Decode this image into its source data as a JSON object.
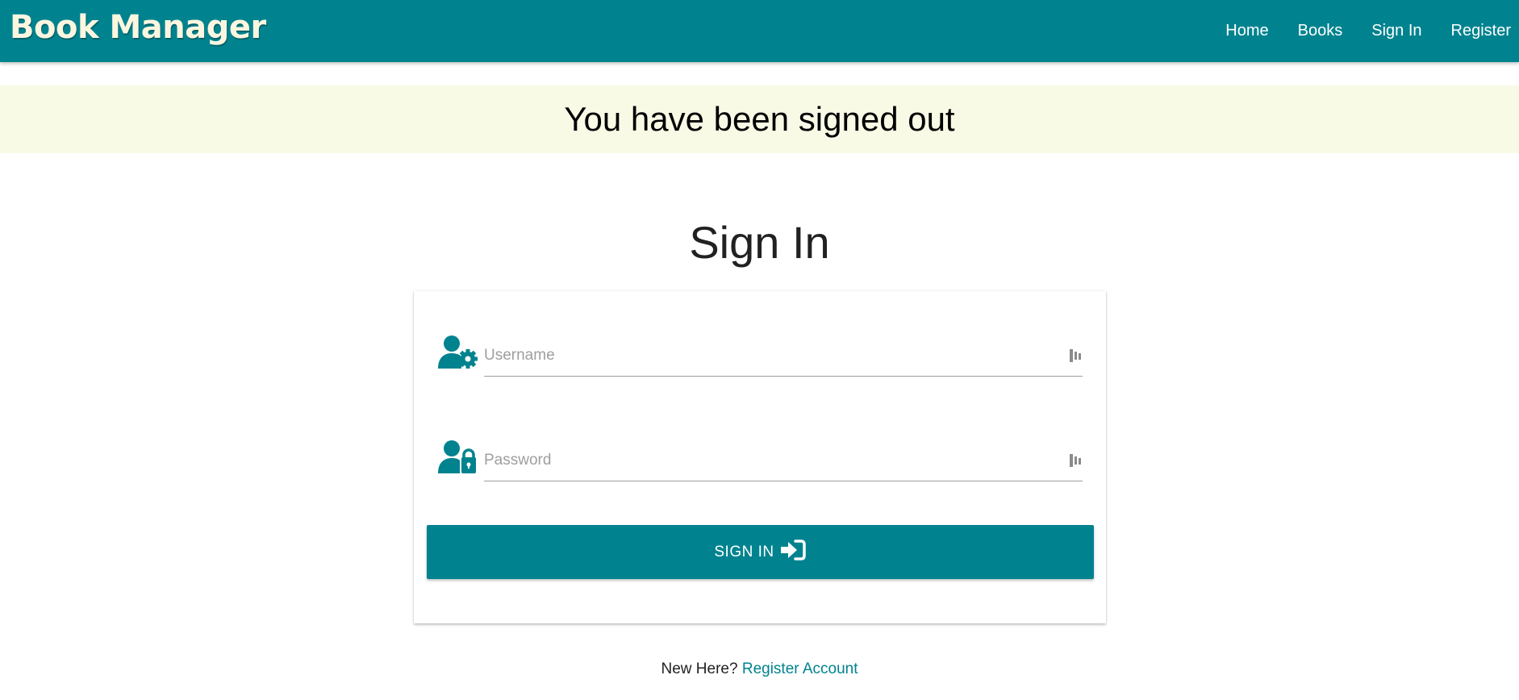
{
  "navbar": {
    "brand": "Book Manager",
    "links": [
      {
        "label": "Home"
      },
      {
        "label": "Books"
      },
      {
        "label": "Sign In"
      },
      {
        "label": "Register"
      }
    ]
  },
  "flash": {
    "message": "You have been signed out"
  },
  "page": {
    "title": "Sign In"
  },
  "form": {
    "username": {
      "placeholder": "Username",
      "value": "",
      "icon": "user-gear-icon"
    },
    "password": {
      "placeholder": "Password",
      "value": "",
      "icon": "user-lock-icon"
    },
    "submit_label": "SIGN IN",
    "submit_icon": "sign-in-arrow-icon"
  },
  "footer": {
    "prompt": "New Here?",
    "register_link": "Register Account"
  },
  "colors": {
    "primary": "#00838f",
    "brand_text": "#fbf6e0",
    "flash_bg": "#f8fae6",
    "link": "#00838f"
  }
}
